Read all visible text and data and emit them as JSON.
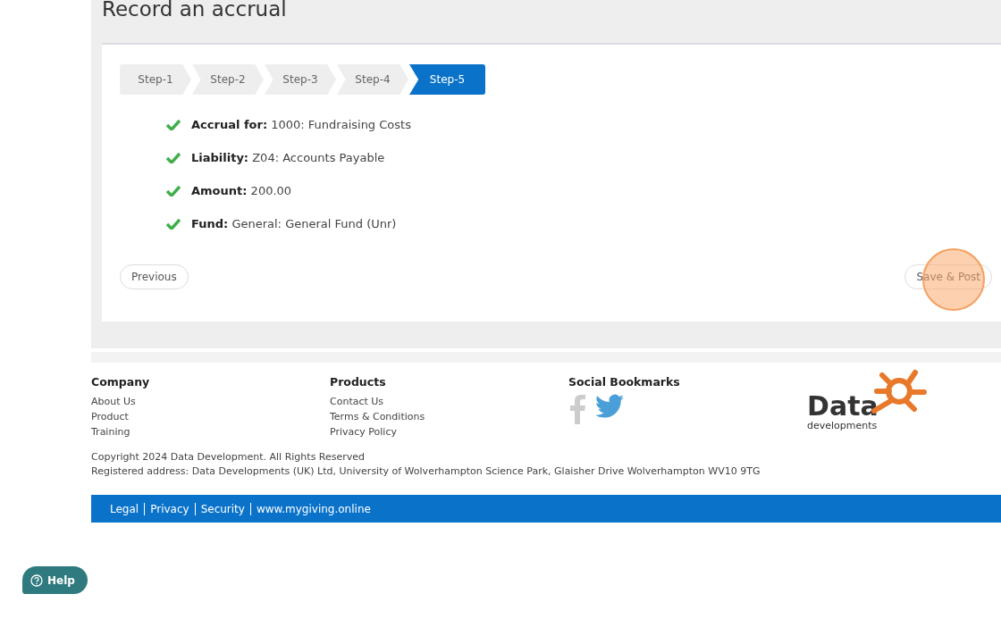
{
  "page": {
    "title": "Record an accrual"
  },
  "steps": [
    {
      "label": "Step-1",
      "selected": false
    },
    {
      "label": "Step-2",
      "selected": false
    },
    {
      "label": "Step-3",
      "selected": false
    },
    {
      "label": "Step-4",
      "selected": false
    },
    {
      "label": "Step-5",
      "selected": true
    }
  ],
  "summary": [
    {
      "label": "Accrual for:",
      "value": "1000: Fundraising Costs",
      "checked": true
    },
    {
      "label": "Liability:",
      "value": "Z04: Accounts Payable",
      "checked": true
    },
    {
      "label": "Amount:",
      "value": "200.00",
      "checked": true
    },
    {
      "label": "Fund:",
      "value": "General: General Fund (Unr)",
      "checked": true
    }
  ],
  "buttons": {
    "previous": "Previous",
    "save": "Save & Post"
  },
  "footer": {
    "columns": [
      {
        "heading": "Company",
        "links": [
          "About Us",
          "Product",
          "Training"
        ]
      },
      {
        "heading": "Products",
        "links": [
          "Contact Us",
          "Terms & Conditions",
          "Privacy Policy"
        ]
      }
    ],
    "social_heading": "Social Bookmarks",
    "logo": {
      "word": "Data",
      "subword": "developments"
    },
    "copyright": "Copyright 2024 Data Development. All Rights Reserved",
    "address": "Registered address: Data Developments (UK) Ltd, University of Wolverhampton Science Park, Glaisher Drive Wolverhampton WV10 9TG",
    "bar_links": [
      "Legal",
      "Privacy",
      "Security",
      "www.mygiving.online"
    ]
  },
  "help": {
    "label": "Help"
  }
}
